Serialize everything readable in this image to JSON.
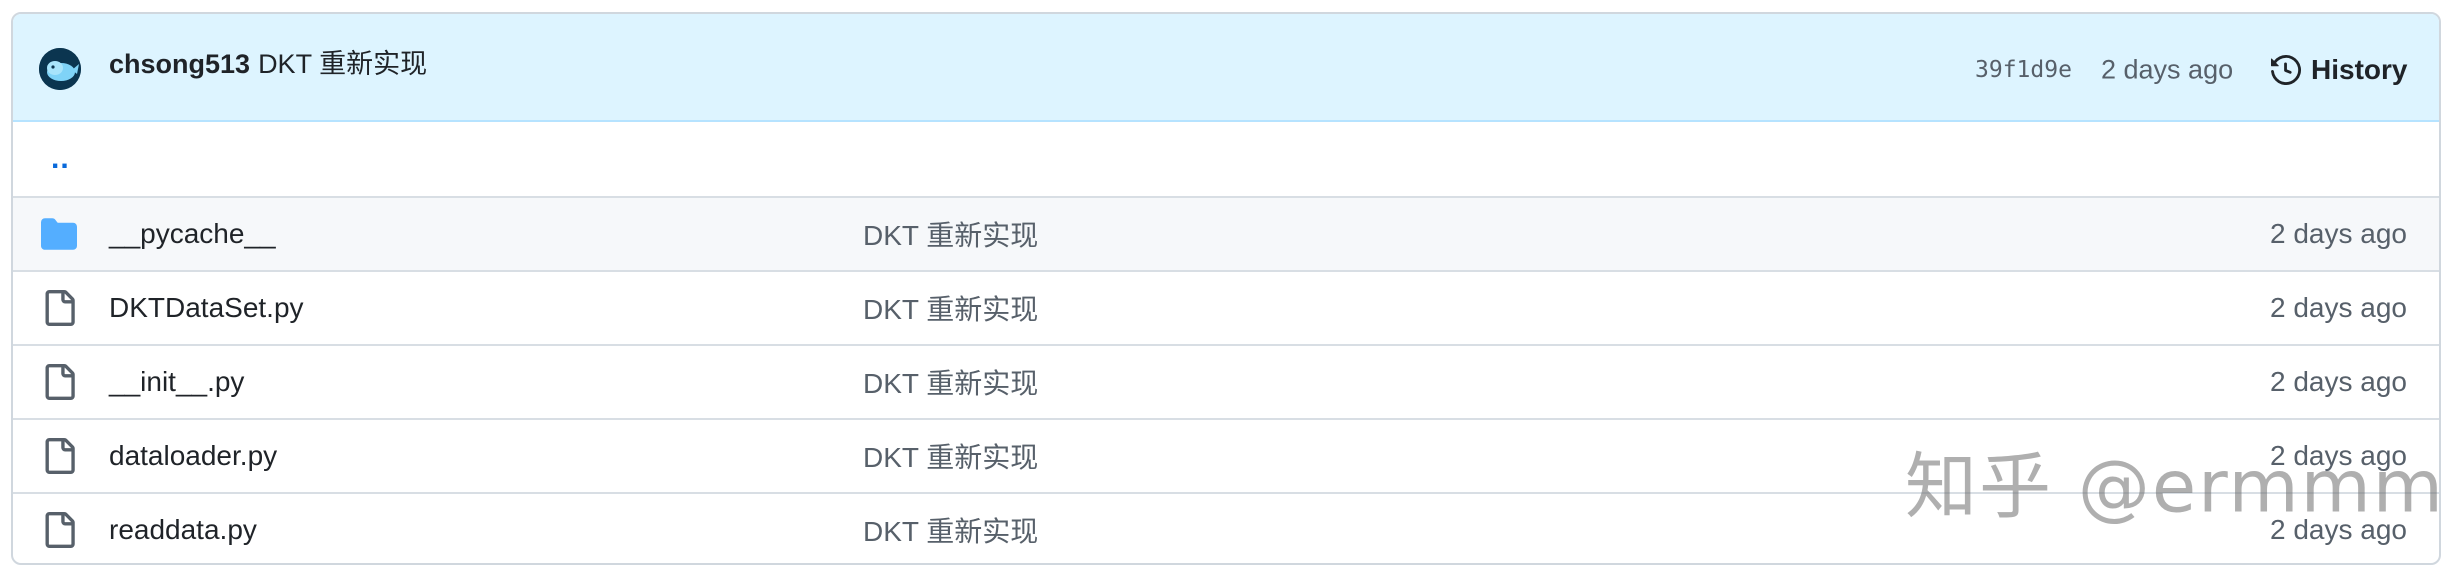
{
  "commit": {
    "author": "chsong513",
    "message": "DKT 重新实现",
    "sha": "39f1d9e",
    "time": "2 days ago",
    "history_label": "History"
  },
  "parent_dir": "..",
  "files": [
    {
      "type": "folder",
      "icon": "folder-icon",
      "name": "__pycache__",
      "message": "DKT 重新实现",
      "time": "2 days ago"
    },
    {
      "type": "file",
      "icon": "file-icon",
      "name": "DKTDataSet.py",
      "message": "DKT 重新实现",
      "time": "2 days ago"
    },
    {
      "type": "file",
      "icon": "file-icon",
      "name": "__init__.py",
      "message": "DKT 重新实现",
      "time": "2 days ago"
    },
    {
      "type": "file",
      "icon": "file-icon",
      "name": "dataloader.py",
      "message": "DKT 重新实现",
      "time": "2 days ago"
    },
    {
      "type": "file",
      "icon": "file-icon",
      "name": "readdata.py",
      "message": "DKT 重新实现",
      "time": "2 days ago"
    }
  ],
  "watermark": "知乎 @ermmm",
  "colors": {
    "commit_bar_bg": "#ddf4ff",
    "link_blue": "#0969da",
    "folder_blue": "#54aeff",
    "muted_text": "#57606a",
    "border": "#d0d7de"
  }
}
